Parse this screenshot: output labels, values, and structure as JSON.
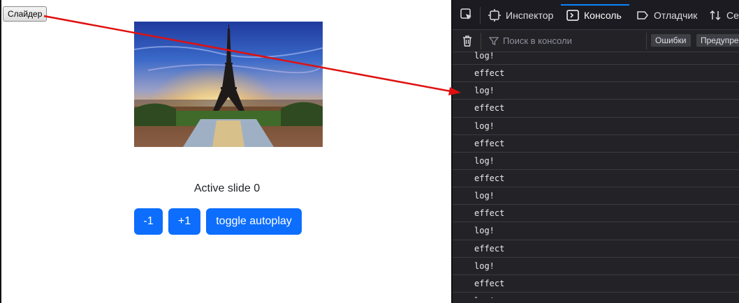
{
  "page": {
    "slider_button": "Слайдер",
    "active_slide_label": "Active slide ",
    "active_slide_index": "0",
    "buttons": {
      "prev": "-1",
      "next": "+1",
      "toggle": "toggle autoplay"
    },
    "accent_color": "#0d6efd"
  },
  "devtools": {
    "tabs": [
      {
        "icon": "pick-element-icon",
        "label": ""
      },
      {
        "icon": "inspector-icon",
        "label": "Инспектор"
      },
      {
        "icon": "console-icon",
        "label": "Консоль"
      },
      {
        "icon": "debugger-icon",
        "label": "Отладчик"
      },
      {
        "icon": "network-icon",
        "label": "Се"
      }
    ],
    "active_tab": "Консоль",
    "filter_placeholder": "Поиск в консоли",
    "levels": [
      "Ошибки",
      "Предупре"
    ],
    "messages": [
      "log!",
      "effect",
      "log!",
      "effect",
      "log!",
      "effect",
      "log!",
      "effect",
      "log!",
      "effect",
      "log!",
      "effect",
      "log!",
      "effect",
      "log!"
    ]
  },
  "annotation": {
    "color": "#e01010"
  }
}
